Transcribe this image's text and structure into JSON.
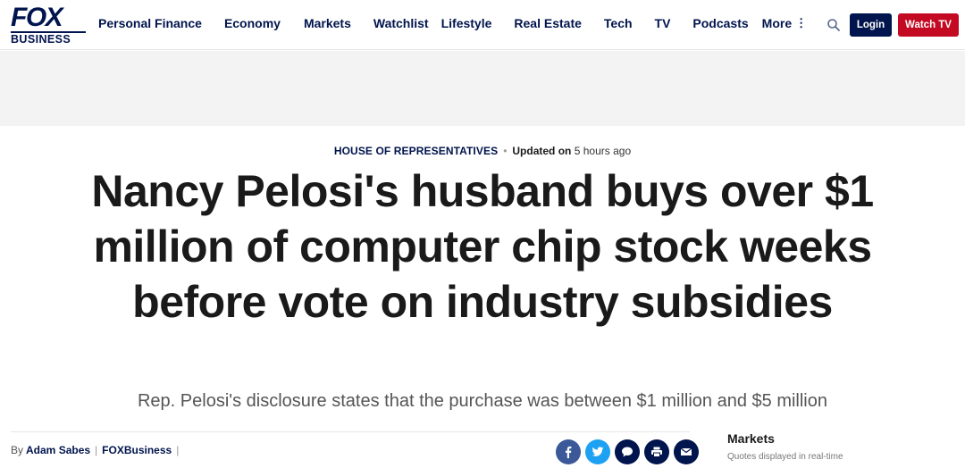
{
  "header": {
    "logo": {
      "top": "FOX",
      "bottom": "BUSINESS"
    },
    "nav": [
      {
        "label": "Personal Finance"
      },
      {
        "label": "Economy"
      },
      {
        "label": "Markets"
      },
      {
        "label": "Watchlist"
      },
      {
        "label": "Lifestyle"
      },
      {
        "label": "Real Estate"
      },
      {
        "label": "Tech"
      },
      {
        "label": "TV"
      },
      {
        "label": "Podcasts"
      },
      {
        "label": "More",
        "icon": "vertical-dots-icon"
      }
    ],
    "search_icon": "search-icon",
    "login_label": "Login",
    "watch_tv_label": "Watch TV",
    "colors": {
      "brand": "#00144d",
      "watch_tv": "#c40a22"
    }
  },
  "article": {
    "category": "HOUSE OF REPRESENTATIVES",
    "updated_label": "Updated on",
    "updated_time": "5 hours ago",
    "headline": "Nancy Pelosi's husband buys over $1 million of computer chip stock weeks before vote on industry subsidies",
    "subhead": "Rep. Pelosi's disclosure states that the purchase was between $1 million and $5 million",
    "byline": {
      "by": "By",
      "author": "Adam Sabes",
      "source": "FOXBusiness"
    },
    "share": [
      {
        "name": "facebook-icon"
      },
      {
        "name": "twitter-icon"
      },
      {
        "name": "comments-icon"
      },
      {
        "name": "print-icon"
      },
      {
        "name": "email-icon"
      }
    ]
  },
  "markets": {
    "title": "Markets",
    "subtitle": "Quotes displayed in real-time"
  }
}
